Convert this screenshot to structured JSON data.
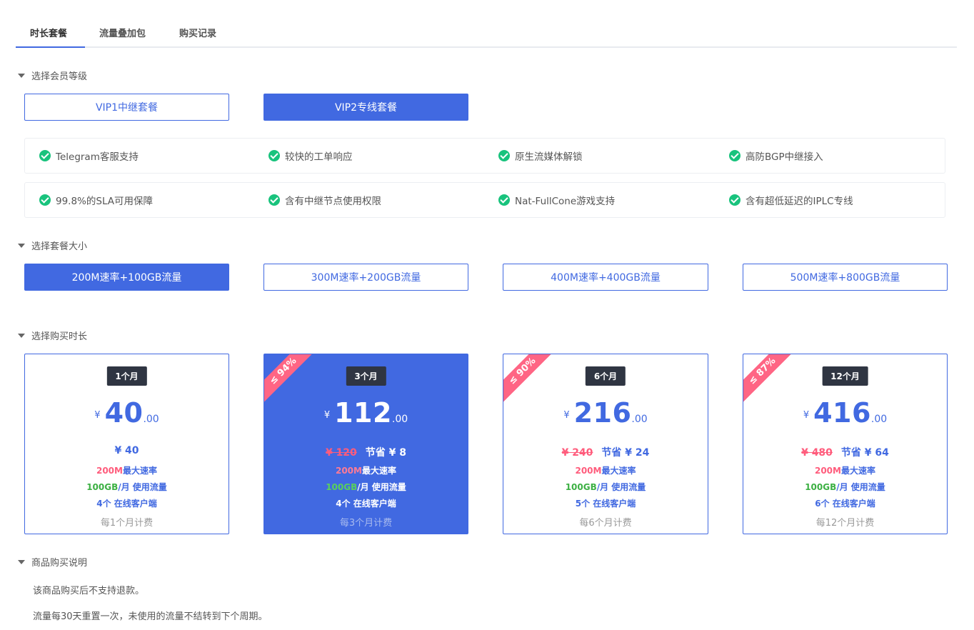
{
  "tabs": [
    "时长套餐",
    "流量叠加包",
    "购买记录"
  ],
  "sections": {
    "level": "选择会员等级",
    "size": "选择套餐大小",
    "duration": "选择购买时长",
    "notes": "商品购买说明"
  },
  "levels": [
    "VIP1中继套餐",
    "VIP2专线套餐"
  ],
  "features_row1": [
    "Telegram客服支持",
    "较快的工单响应",
    "原生流媒体解锁",
    "高防BGP中继接入"
  ],
  "features_row2": [
    "99.8%的SLA可用保障",
    "含有中继节点使用权限",
    "Nat-FullCone游戏支持",
    "含有超低延迟的IPLC专线"
  ],
  "sizes": [
    "200M速率+100GB流量",
    "300M速率+200GB流量",
    "400M速率+400GB流量",
    "500M速率+800GB流量"
  ],
  "cards": [
    {
      "month": "1个月",
      "currency": "¥",
      "int": "40",
      "dec": ".00",
      "orig": "",
      "save": "¥ 40",
      "speed": "200M",
      "speed_label": "最大速率",
      "traffic": "100GB",
      "traffic_label": "/月 使用流量",
      "clients": "4个 在线客户端",
      "billing": "每1个月计费",
      "ribbon": ""
    },
    {
      "month": "3个月",
      "currency": "¥",
      "int": "112",
      "dec": ".00",
      "orig": "¥ 120",
      "save": "节省 ¥ 8",
      "speed": "200M",
      "speed_label": "最大速率",
      "traffic": "100GB",
      "traffic_label": "/月 使用流量",
      "clients": "4个 在线客户端",
      "billing": "每3个月计费",
      "ribbon": "≤ 94%"
    },
    {
      "month": "6个月",
      "currency": "¥",
      "int": "216",
      "dec": ".00",
      "orig": "¥ 240",
      "save": "节省 ¥ 24",
      "speed": "200M",
      "speed_label": "最大速率",
      "traffic": "100GB",
      "traffic_label": "/月 使用流量",
      "clients": "5个 在线客户端",
      "billing": "每6个月计费",
      "ribbon": "≤ 90%"
    },
    {
      "month": "12个月",
      "currency": "¥",
      "int": "416",
      "dec": ".00",
      "orig": "¥ 480",
      "save": "节省 ¥ 64",
      "speed": "200M",
      "speed_label": "最大速率",
      "traffic": "100GB",
      "traffic_label": "/月 使用流量",
      "clients": "6个 在线客户端",
      "billing": "每12个月计费",
      "ribbon": "≤ 87%"
    }
  ],
  "notes": [
    "该商品购买后不支持退款。",
    "流量每30天重置一次，未使用的流量不结转到下个周期。"
  ],
  "colors": {
    "accent": "#4169e1",
    "check": "#19c37d",
    "ribbon": "#ff6584",
    "badge": "#2f3542"
  }
}
